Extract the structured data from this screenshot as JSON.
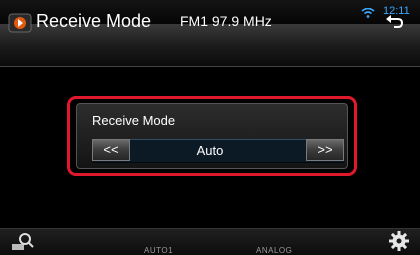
{
  "status": {
    "time": "12:11"
  },
  "header": {
    "title": "Receive Mode",
    "frequency": "FM1 97.9 MHz"
  },
  "panel": {
    "label": "Receive Mode",
    "value": "Auto",
    "prev_label": "<<",
    "next_label": ">>"
  },
  "bottom": {
    "tab_auto": "AUTO1",
    "tab_analog": "ANALOG"
  },
  "colors": {
    "highlight": "#e0182c",
    "accent": "#3ba7ff"
  },
  "icons": [
    "wifi-icon",
    "source-icon",
    "back-icon",
    "search-icon",
    "gear-icon"
  ]
}
